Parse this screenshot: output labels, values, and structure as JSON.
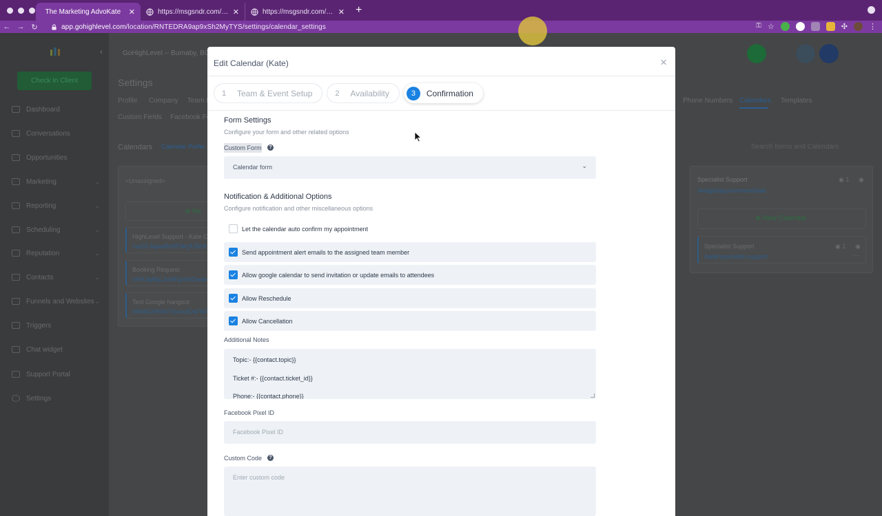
{
  "browser": {
    "tabs": [
      {
        "title": "The Marketing AdvoKate",
        "active": true
      },
      {
        "title": "https://msgsndr.com/widget/a",
        "active": false
      },
      {
        "title": "https://msgsndr.com/widget/a",
        "active": false
      }
    ],
    "url_domain": "app.gohighlevel.com",
    "url_path": "/location/RNTEDRA9ap9xSh2MyTYS/settings/calendar_settings"
  },
  "sidebar": {
    "check_in": "Check In Client",
    "items": [
      {
        "label": "Dashboard",
        "caret": false
      },
      {
        "label": "Conversations",
        "caret": false
      },
      {
        "label": "Opportunities",
        "caret": false
      },
      {
        "label": "Marketing",
        "caret": true
      },
      {
        "label": "Reporting",
        "caret": true
      },
      {
        "label": "Scheduling",
        "caret": true
      },
      {
        "label": "Reputation",
        "caret": true
      },
      {
        "label": "Contacts",
        "caret": true
      },
      {
        "label": "Funnels and Websites",
        "caret": true
      },
      {
        "label": "Triggers",
        "caret": false
      },
      {
        "label": "Chat widget",
        "caret": false
      },
      {
        "label": "Support Portal",
        "caret": false
      },
      {
        "label": "Settings",
        "caret": false
      }
    ]
  },
  "background": {
    "location": "GoHighLevel -- Burnaby, BC",
    "settings_title": "Settings",
    "tabs_row1": [
      "Profile",
      "Company",
      "Team M",
      "Phone Numbers",
      "Calendars",
      "Templates"
    ],
    "tabs_row2": [
      "Custom Fields",
      "Facebook For"
    ],
    "calendars_title": "Calendars",
    "calendar_preferences": "Calendar Prefer",
    "search_placeholder": "Search forms and Calendars",
    "unassigned": "<Unassigned>",
    "new_short": "Ne",
    "cards": [
      {
        "title": "HighLevel Support - Kate Ch",
        "link": "/uzGFJiqaaRn0F5kQUNOH"
      },
      {
        "title": "Booking Request",
        "link": "/vKK4g8qL2m8IQsheDwoe"
      },
      {
        "title": "Test Google hangout",
        "link": "/Wb9GH50NTSumztDsFKFs"
      }
    ],
    "group": {
      "title": "Specialist Support",
      "link": "/widget/appointment/kate",
      "count": "1"
    },
    "new_calendar": "New Calendar",
    "calendar_item": {
      "title": "Specialist Support",
      "link": "/kate/specialist-support",
      "count": "1"
    }
  },
  "modal": {
    "title": "Edit Calendar (Kate)",
    "close_icon": "close-icon",
    "steps": [
      {
        "num": "1",
        "label": "Team & Event Setup",
        "active": false
      },
      {
        "num": "2",
        "label": "Availability",
        "active": false
      },
      {
        "num": "3",
        "label": "Confirmation",
        "active": true
      }
    ],
    "form_settings": {
      "title": "Form Settings",
      "subtitle": "Configure your form and other related options",
      "custom_form_label": "Custom Form",
      "custom_form_value": "Calendar form"
    },
    "notifications": {
      "title": "Notification & Additional Options",
      "subtitle": "Configure notification and other miscellaneous options",
      "options": [
        {
          "label": "Let the calendar auto confirm my appointment",
          "checked": false
        },
        {
          "label": "Send appointment alert emails to the assigned team member",
          "checked": true
        },
        {
          "label": "Allow google calendar to send invitation or update emails to attendees",
          "checked": true
        },
        {
          "label": "Allow Reschedule",
          "checked": true
        },
        {
          "label": "Allow Cancellation",
          "checked": true
        }
      ]
    },
    "additional_notes": {
      "label": "Additional Notes",
      "lines": [
        "Topic:- {{contact.topic}}",
        "Ticket #:- {{contact.ticket_id}}",
        "Phone:- {{contact.phone}}"
      ]
    },
    "facebook_pixel": {
      "label": "Facebook Pixel ID",
      "placeholder": "Facebook Pixel ID"
    },
    "custom_code": {
      "label": "Custom Code",
      "placeholder": "Enter custom code"
    }
  }
}
